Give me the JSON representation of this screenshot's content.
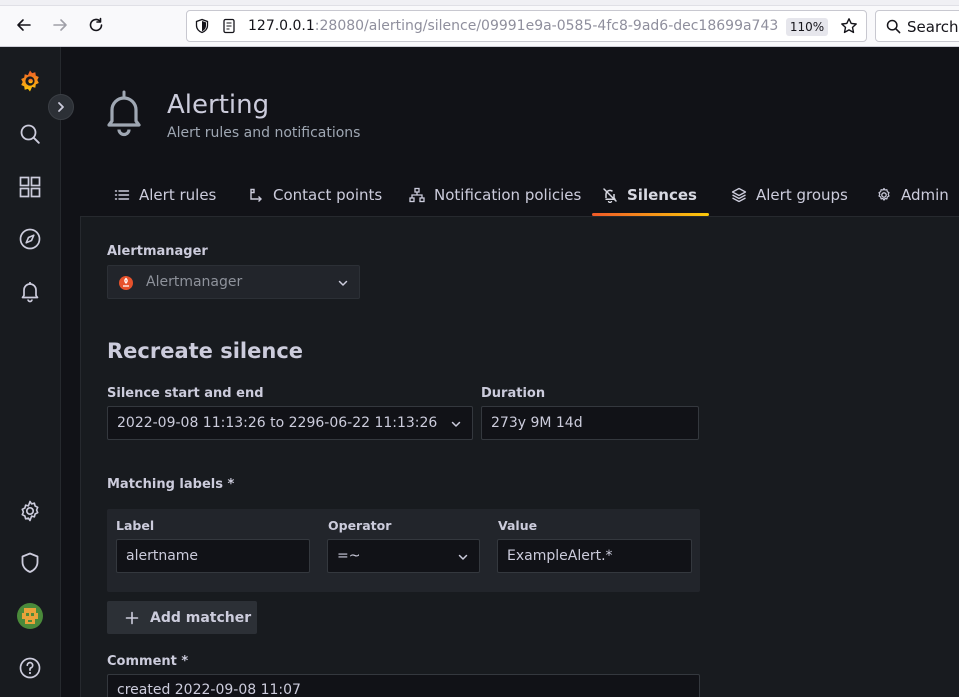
{
  "browser": {
    "url_host": "127.0.0.1",
    "url_rest": ":28080/alerting/silence/09991e9a-0585-4fc8-9ad6-dec18699a743",
    "zoom": "110%",
    "search_label": "Search"
  },
  "sidemenu": {
    "items": [
      "grafana-logo-icon",
      "search-icon",
      "dashboards-icon",
      "explore-icon",
      "alerting-icon",
      "settings-icon",
      "shield-icon",
      "avatar",
      "help-icon"
    ]
  },
  "header": {
    "title": "Alerting",
    "subtitle": "Alert rules and notifications"
  },
  "tabs": [
    {
      "label": "Alert rules",
      "icon": "list-icon"
    },
    {
      "label": "Contact points",
      "icon": "contact-icon"
    },
    {
      "label": "Notification policies",
      "icon": "sitemap-icon"
    },
    {
      "label": "Silences",
      "icon": "bell-slash-icon",
      "active": true
    },
    {
      "label": "Alert groups",
      "icon": "layers-icon"
    },
    {
      "label": "Admin",
      "icon": "cog-icon"
    }
  ],
  "form": {
    "alertmanager_label": "Alertmanager",
    "alertmanager_value": "Alertmanager",
    "section_title": "Recreate silence",
    "start_end_label": "Silence start and end",
    "start_end_value": "2022-09-08 11:13:26 to 2296-06-22 11:13:26",
    "duration_label": "Duration",
    "duration_value": "273y 9M 14d",
    "matching_labels_label": "Matching labels *",
    "matcher": {
      "label_header": "Label",
      "operator_header": "Operator",
      "value_header": "Value",
      "label_value": "alertname",
      "operator_value": "=~",
      "value_value": "ExampleAlert.*"
    },
    "add_matcher_label": "Add matcher",
    "comment_label": "Comment *",
    "comment_value": "created 2022-09-08 11:07"
  },
  "colors": {
    "accent_gradient_start": "#f05a28",
    "accent_gradient_end": "#fbca0a",
    "background": "#111217",
    "panel": "#181b1f"
  }
}
